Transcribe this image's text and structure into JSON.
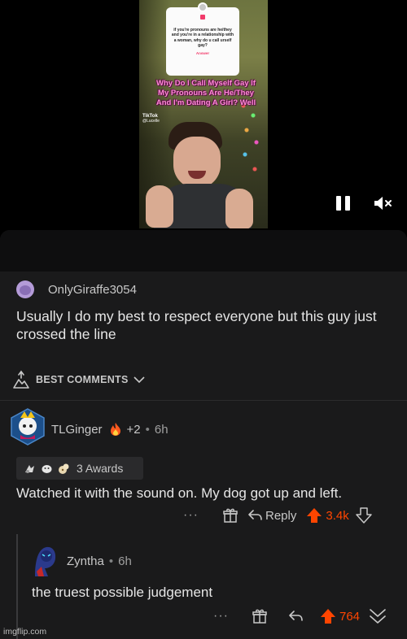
{
  "video": {
    "question_text": "if you're pronouns are he/they and you're in a relationship with a woman, why do u call urself gay?",
    "answer_label": "Answer",
    "overlay_caption": "Why Do I Call Myself Gay If My Pronouns Are He/They And I'm Dating A Girl? Well",
    "tiktok_label": "TikTok",
    "tiktok_handle": "@Lucelle",
    "controls": {
      "pause_icon": "pause-icon",
      "mute_icon": "muted-speaker-icon"
    }
  },
  "post": {
    "author": "OnlyGiraffe3054",
    "body": "Usually I do my best to respect everyone but this guy just crossed the line"
  },
  "sort": {
    "label": "BEST COMMENTS",
    "icon": "sort-icon"
  },
  "comments": [
    {
      "author": "TLGinger",
      "flair_extra": "+2",
      "separator": "•",
      "time": "6h",
      "awards_label": "3 Awards",
      "body": "Watched it with the sound on. My dog got up and left.",
      "more": "···",
      "reply_label": "Reply",
      "score": "3.4k"
    },
    {
      "author": "Zyntha",
      "separator": "•",
      "time": "6h",
      "body": "the truest possible judgement",
      "more": "···",
      "score": "764"
    }
  ],
  "watermark": "imgflip.com",
  "colors": {
    "background": "#1a1a1b",
    "upvote": "#ff4500",
    "text": "#e6e6e6",
    "muted": "#c8c8c8"
  }
}
